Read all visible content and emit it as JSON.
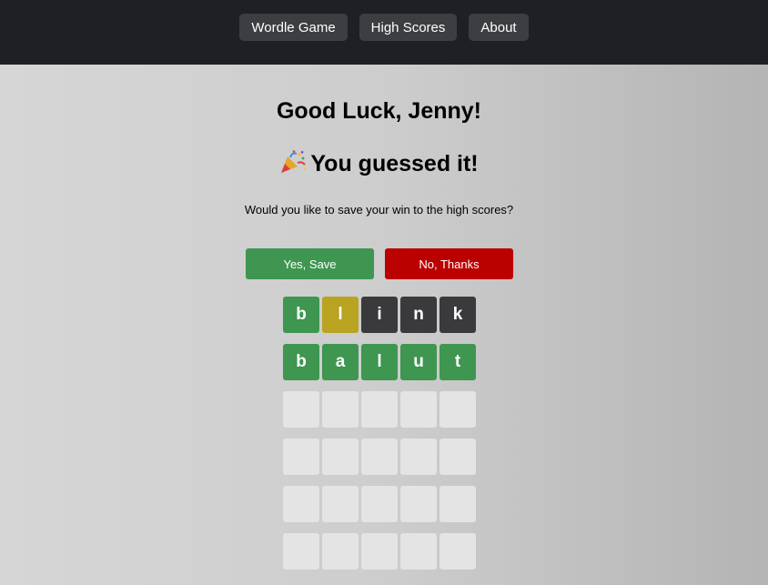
{
  "nav": {
    "items": [
      {
        "label": "Wordle Game"
      },
      {
        "label": "High Scores"
      },
      {
        "label": "About"
      }
    ]
  },
  "main": {
    "greeting": "Good Luck, Jenny!",
    "win_message": "You guessed it!",
    "win_icon": "party-popper-icon",
    "save_prompt": "Would you like to save your win to the high scores?",
    "yes_label": "Yes, Save",
    "no_label": "No, Thanks"
  },
  "colors": {
    "correct": "#3e9650",
    "present": "#b8a420",
    "absent": "#3a3a3c",
    "empty": "#e4e4e4",
    "no_button": "#bb0000",
    "topbar": "#1f2024"
  },
  "board": {
    "rows": [
      [
        {
          "letter": "b",
          "state": "correct"
        },
        {
          "letter": "l",
          "state": "present"
        },
        {
          "letter": "i",
          "state": "absent"
        },
        {
          "letter": "n",
          "state": "absent"
        },
        {
          "letter": "k",
          "state": "absent"
        }
      ],
      [
        {
          "letter": "b",
          "state": "correct"
        },
        {
          "letter": "a",
          "state": "correct"
        },
        {
          "letter": "l",
          "state": "correct"
        },
        {
          "letter": "u",
          "state": "correct"
        },
        {
          "letter": "t",
          "state": "correct"
        }
      ],
      [
        {
          "letter": "",
          "state": "empty"
        },
        {
          "letter": "",
          "state": "empty"
        },
        {
          "letter": "",
          "state": "empty"
        },
        {
          "letter": "",
          "state": "empty"
        },
        {
          "letter": "",
          "state": "empty"
        }
      ],
      [
        {
          "letter": "",
          "state": "empty"
        },
        {
          "letter": "",
          "state": "empty"
        },
        {
          "letter": "",
          "state": "empty"
        },
        {
          "letter": "",
          "state": "empty"
        },
        {
          "letter": "",
          "state": "empty"
        }
      ],
      [
        {
          "letter": "",
          "state": "empty"
        },
        {
          "letter": "",
          "state": "empty"
        },
        {
          "letter": "",
          "state": "empty"
        },
        {
          "letter": "",
          "state": "empty"
        },
        {
          "letter": "",
          "state": "empty"
        }
      ],
      [
        {
          "letter": "",
          "state": "empty"
        },
        {
          "letter": "",
          "state": "empty"
        },
        {
          "letter": "",
          "state": "empty"
        },
        {
          "letter": "",
          "state": "empty"
        },
        {
          "letter": "",
          "state": "empty"
        }
      ]
    ]
  }
}
